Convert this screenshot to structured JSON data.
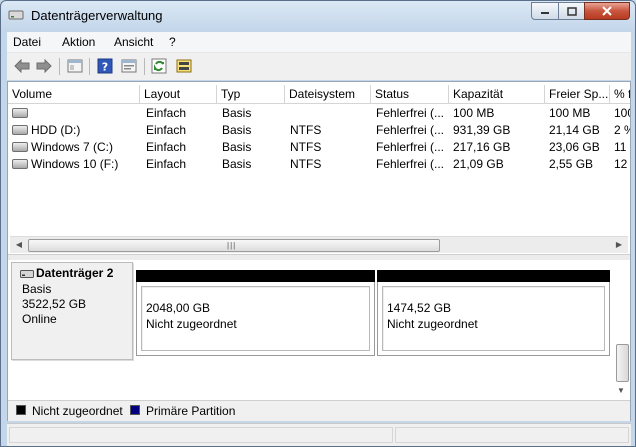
{
  "window": {
    "title": "Datenträgerverwaltung"
  },
  "menu": [
    "Datei",
    "Aktion",
    "Ansicht",
    "?"
  ],
  "toolbar": {
    "icons": [
      "back-arrow-icon",
      "forward-arrow-icon",
      "console-tree-icon",
      "help-icon",
      "properties-icon",
      "refresh-icon",
      "rescan-disks-icon"
    ]
  },
  "volume_table": {
    "columns": [
      "Volume",
      "Layout",
      "Typ",
      "Dateisystem",
      "Status",
      "Kapazität",
      "Freier Sp...",
      "% f"
    ],
    "rows": [
      {
        "volume": "",
        "layout": "Einfach",
        "typ": "Basis",
        "dateisystem": "",
        "status": "Fehlerfrei (...",
        "kapazitaet": "100 MB",
        "frei": "100 MB",
        "prozent": "100"
      },
      {
        "volume": "HDD (D:)",
        "layout": "Einfach",
        "typ": "Basis",
        "dateisystem": "NTFS",
        "status": "Fehlerfrei (...",
        "kapazitaet": "931,39 GB",
        "frei": "21,14 GB",
        "prozent": "2 %"
      },
      {
        "volume": "Windows 7 (C:)",
        "layout": "Einfach",
        "typ": "Basis",
        "dateisystem": "NTFS",
        "status": "Fehlerfrei (...",
        "kapazitaet": "217,16 GB",
        "frei": "23,06 GB",
        "prozent": "11"
      },
      {
        "volume": "Windows 10 (F:)",
        "layout": "Einfach",
        "typ": "Basis",
        "dateisystem": "NTFS",
        "status": "Fehlerfrei (...",
        "kapazitaet": "21,09 GB",
        "frei": "2,55 GB",
        "prozent": "12"
      }
    ]
  },
  "disk": {
    "name": "Datenträger 2",
    "type": "Basis",
    "size": "3522,52 GB",
    "state": "Online",
    "partitions": [
      {
        "size": "2048,00 GB",
        "status": "Nicht zugeordnet"
      },
      {
        "size": "1474,52 GB",
        "status": "Nicht zugeordnet"
      }
    ]
  },
  "legend": [
    {
      "label": "Nicht zugeordnet",
      "color": "#000000"
    },
    {
      "label": "Primäre Partition",
      "color": "#000080"
    }
  ],
  "colors": {
    "unallocated": "#000000",
    "primary": "#000080",
    "close_button": "#c8553e"
  }
}
